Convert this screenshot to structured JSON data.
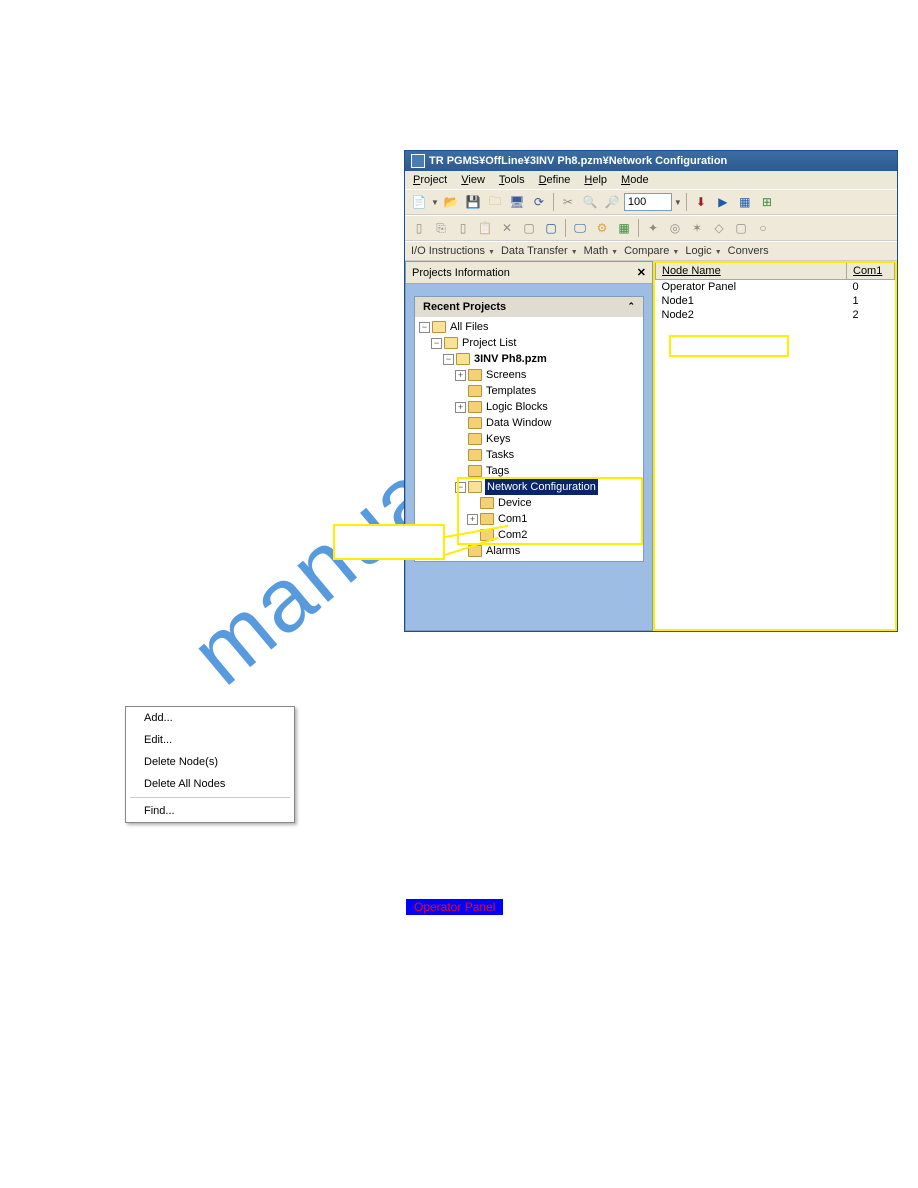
{
  "titlebar": "TR PGMS¥OffLine¥3INV Ph8.pzm¥Network Configuration",
  "menubar": [
    "Project",
    "View",
    "Tools",
    "Define",
    "Help",
    "Mode"
  ],
  "toolbar": {
    "zoom": "100"
  },
  "category_bar": [
    "I/O Instructions",
    "Data Transfer",
    "Math",
    "Compare",
    "Logic",
    "Convers"
  ],
  "projects_panel": {
    "title": "Projects Information",
    "recent_header": "Recent Projects"
  },
  "tree": {
    "all_files": "All Files",
    "project_list": "Project List",
    "project_name": "3INV Ph8.pzm",
    "items": {
      "screens": "Screens",
      "templates": "Templates",
      "logic_blocks": "Logic Blocks",
      "data_window": "Data Window",
      "keys": "Keys",
      "tasks": "Tasks",
      "tags": "Tags",
      "network_config": "Network Configuration",
      "device": "Device",
      "com1": "Com1",
      "com2": "Com2",
      "alarms": "Alarms"
    }
  },
  "node_table": {
    "headers": [
      "Node Name",
      "Com1"
    ],
    "rows": [
      {
        "name": "Operator Panel",
        "com": "0"
      },
      {
        "name": "Node1",
        "com": "1"
      },
      {
        "name": "Node2",
        "com": "2"
      }
    ]
  },
  "context_menu": {
    "add": "Add...",
    "edit": "Edit...",
    "delete_nodes": "Delete Node(s)",
    "delete_all": "Delete All Nodes",
    "find": "Find..."
  },
  "operator_panel_label": "Operator Panel"
}
